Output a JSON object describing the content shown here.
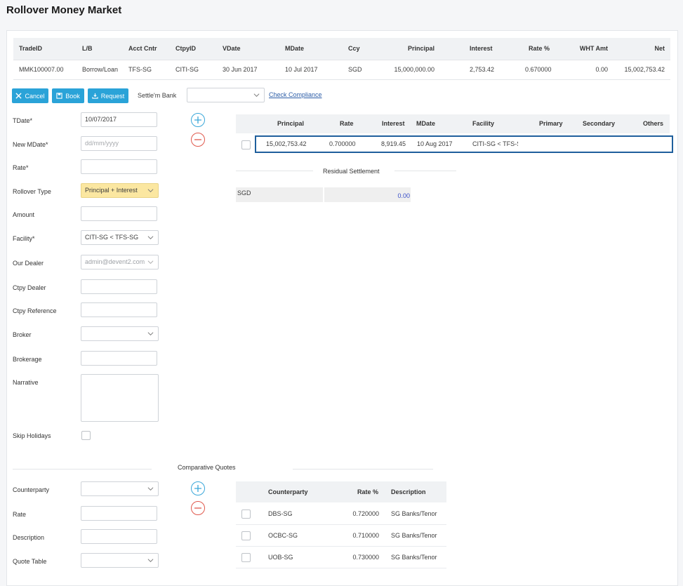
{
  "title": "Rollover Money Market",
  "summary": {
    "headers": [
      "TradeID",
      "L/B",
      "Acct Cntr",
      "CtpyID",
      "VDate",
      "MDate",
      "Ccy",
      "Principal",
      "Interest",
      "Rate %",
      "WHT Amt",
      "Net"
    ],
    "row": [
      "MMK100007.00",
      "Borrow/Loan",
      "TFS-SG",
      "CITI-SG",
      "30 Jun 2017",
      "10 Jul 2017",
      "SGD",
      "15,000,000.00",
      "2,753.42",
      "0.670000",
      "0.00",
      "15,002,753.42"
    ]
  },
  "toolbar": {
    "cancel": "Cancel",
    "book": "Book",
    "request": "Request",
    "settle_bank_label": "Settle'm Bank",
    "settle_bank_value": "",
    "check_compliance": "Check Compliance"
  },
  "form": {
    "tdate_label": "TDate*",
    "tdate_value": "10/07/2017",
    "new_mdate_label": "New MDate*",
    "new_mdate_placeholder": "dd/mm/yyyy",
    "rate_label": "Rate*",
    "rate_value": "",
    "rollover_type_label": "Rollover Type",
    "rollover_type_value": "Principal + Interest",
    "amount_label": "Amount",
    "amount_value": "",
    "facility_label": "Facility*",
    "facility_value": "CITI-SG < TFS-SG",
    "our_dealer_label": "Our Dealer",
    "our_dealer_value": "admin@devent2.com",
    "ctpy_dealer_label": "Ctpy Dealer",
    "ctpy_dealer_value": "",
    "ctpy_reference_label": "Ctpy Reference",
    "ctpy_reference_value": "",
    "broker_label": "Broker",
    "broker_value": "",
    "brokerage_label": "Brokerage",
    "brokerage_value": "",
    "narrative_label": "Narrative",
    "narrative_value": "",
    "skip_holidays_label": "Skip Holidays"
  },
  "rollover_table": {
    "headers": [
      "Principal",
      "Rate",
      "Interest",
      "MDate",
      "Facility",
      "Primary",
      "Secondary",
      "Others"
    ],
    "row": [
      "15,002,753.42",
      "0.700000",
      "8,919.45",
      "10 Aug 2017",
      "CITI-SG < TFS-SC",
      "",
      "",
      ""
    ]
  },
  "residual": {
    "title": "Residual Settlement",
    "ccy": "SGD",
    "amount": "0.00"
  },
  "quotes": {
    "title": "Comparative Quotes",
    "counterparty_label": "Counterparty",
    "counterparty_value": "",
    "rate_label": "Rate",
    "rate_value": "",
    "description_label": "Description",
    "description_value": "",
    "quote_table_label": "Quote Table",
    "quote_table_value": "",
    "headers": [
      "Counterparty",
      "Rate %",
      "Description"
    ],
    "rows": [
      {
        "counterparty": "DBS-SG",
        "rate": "0.720000",
        "description": "SG Banks/Tenor"
      },
      {
        "counterparty": "OCBC-SG",
        "rate": "0.710000",
        "description": "SG Banks/Tenor"
      },
      {
        "counterparty": "UOB-SG",
        "rate": "0.730000",
        "description": "SG Banks/Tenor"
      }
    ]
  },
  "colors": {
    "primary_button": "#2aa3d8",
    "highlight_border": "#1f5f9c",
    "rollover_type_bg": "#fbe7a1",
    "add_icon": "#3aa7d9",
    "remove_icon": "#e0594d"
  },
  "icons": {
    "cancel": "close-icon",
    "book": "save-icon",
    "request": "download-icon",
    "dropdown": "chevron-down-icon",
    "add": "plus-circle-icon",
    "remove": "minus-circle-icon"
  }
}
